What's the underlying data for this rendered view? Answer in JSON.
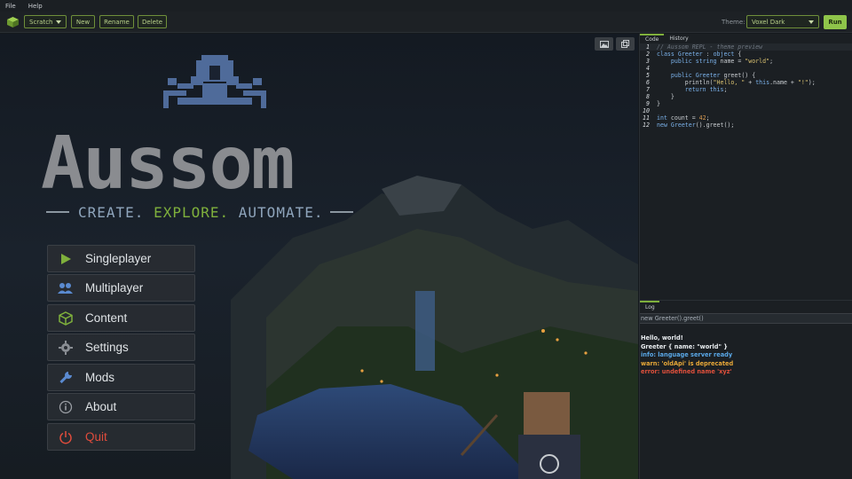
{
  "menubar": {
    "file": "File",
    "help": "Help"
  },
  "toolbar": {
    "project_select": "Scratch",
    "new_label": "New",
    "rename_label": "Rename",
    "delete_label": "Delete",
    "theme_label": "Theme:",
    "theme_select": "Voxel Dark",
    "run_label": "Run"
  },
  "preview": {
    "title_logo": "Aussom",
    "tagline": {
      "create": "CREATE.",
      "explore": "EXPLORE.",
      "automate": "AUTOMATE."
    },
    "menu": [
      {
        "label": "Singleplayer",
        "icon": "play-icon"
      },
      {
        "label": "Multiplayer",
        "icon": "users-icon"
      },
      {
        "label": "Content",
        "icon": "cube-icon"
      },
      {
        "label": "Settings",
        "icon": "gear-icon"
      },
      {
        "label": "Mods",
        "icon": "wrench-icon"
      },
      {
        "label": "About",
        "icon": "info-icon"
      },
      {
        "label": "Quit",
        "icon": "power-icon"
      }
    ],
    "colors": {
      "accent": "#7fb03c",
      "quit": "#e04c3c"
    }
  },
  "editor": {
    "tabs": [
      "Code",
      "History"
    ],
    "lines": [
      {
        "n": "1",
        "html": "<span class='cm'>// Aussom REPL - theme preview</span>"
      },
      {
        "n": "2",
        "html": "<span class='kw'>class</span> <span class='kw'>Greeter</span> : <span class='kw'>object</span> {"
      },
      {
        "n": "3",
        "html": "    <span class='kw'>public</span> <span class='kw'>string</span> name = <span class='st'>\"world\"</span>;"
      },
      {
        "n": "4",
        "html": ""
      },
      {
        "n": "5",
        "html": "    <span class='kw'>public</span> <span class='kw'>Greeter</span> greet() {"
      },
      {
        "n": "6",
        "html": "        println(<span class='st'>\"Hello, \"</span> + <span class='kw'>this</span>.name + <span class='st'>\"!\"</span>);"
      },
      {
        "n": "7",
        "html": "        <span class='kw'>return</span> <span class='kw'>this</span>;"
      },
      {
        "n": "8",
        "html": "    }"
      },
      {
        "n": "9",
        "html": "}"
      },
      {
        "n": "10",
        "html": ""
      },
      {
        "n": "11",
        "html": "<span class='kw'>int</span> count = <span class='nu'>42</span>;"
      },
      {
        "n": "12",
        "html": "<span class='kw'>new</span> <span class='kw'>Greeter</span>().greet();"
      }
    ]
  },
  "log": {
    "tab": "Log",
    "input_value": "new Greeter().greet()",
    "lines": [
      {
        "text": "Hello, world!",
        "color": "#e8ecef"
      },
      {
        "text": "Greeter { name: \"world\" }",
        "color": "#e8ecef"
      },
      {
        "text": "info: language server ready",
        "color": "#5aa8e8"
      },
      {
        "text": "warn: 'oldApi' is deprecated",
        "color": "#e8a838"
      },
      {
        "text": "error: undefined name 'xyz'",
        "color": "#e0503c"
      }
    ]
  }
}
